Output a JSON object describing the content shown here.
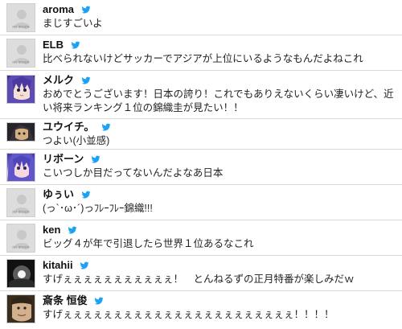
{
  "placeholder": {
    "label": "no image"
  },
  "colors": {
    "twitter_blue": "#1da1f2"
  },
  "posts": [
    {
      "user": "aroma",
      "avatar": "default",
      "text": "まじすごいよ"
    },
    {
      "user": "ELB",
      "avatar": "default",
      "text": "比べられないけどサッカーでアジアが上位にいるようなもんだよねこれ"
    },
    {
      "user": "メルク",
      "avatar": "anime-purple-hair",
      "text": "おめでとうございます！日本の誇り！これでもありえないくらい凄いけど、近い将来ランキング１位の錦織圭が見たい！！"
    },
    {
      "user": "ユウイチ。",
      "avatar": "anime-dark",
      "text": "つよい(小並感)"
    },
    {
      "user": "リボーン",
      "avatar": "anime-purple-hair",
      "text": "こいつしか目だってないんだよなあ日本"
    },
    {
      "user": "ゆぅい",
      "avatar": "default",
      "text": "(っ`･ω･´)っﾌﾚｰﾌﾚｰ錦織!!!"
    },
    {
      "user": "ken",
      "avatar": "default",
      "text": "ビッグ４が年で引退したら世界１位あるなこれ"
    },
    {
      "user": "kitahii",
      "avatar": "photo",
      "text": "すげぇぇぇぇぇぇぇぇぇぇぇ！　とんねるずの正月特番が楽しみだｗ"
    },
    {
      "user": "斎条 恒俊",
      "avatar": "photo",
      "text": "すげぇぇぇぇぇぇぇぇぇぇぇぇぇぇぇぇぇぇぇぇぇぇぇ！！！！"
    }
  ]
}
